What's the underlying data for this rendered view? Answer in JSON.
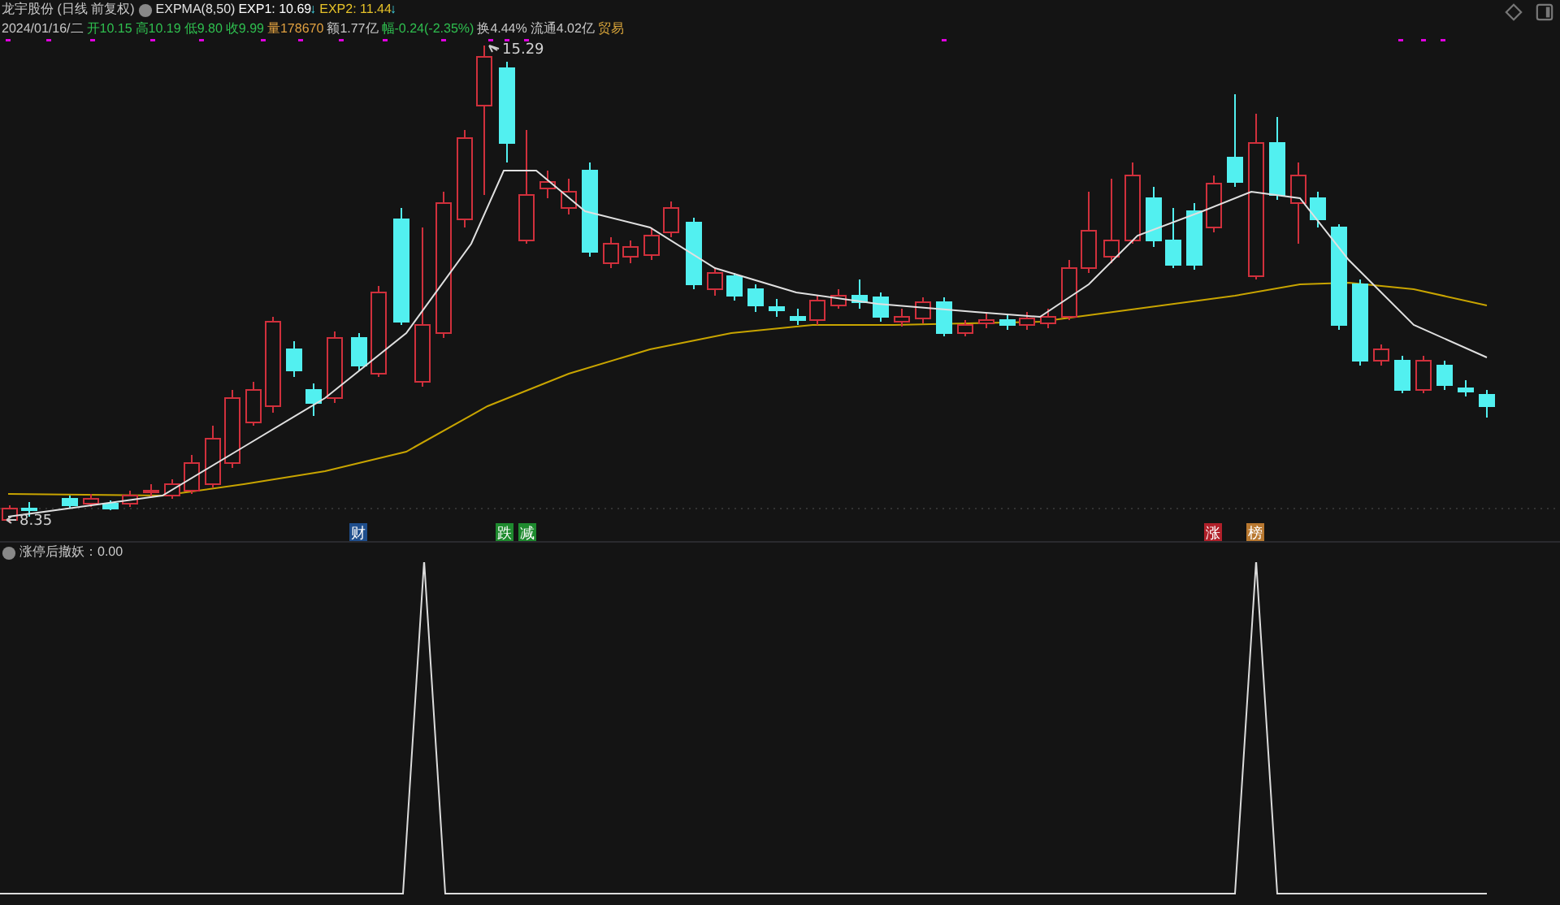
{
  "header": {
    "title": "龙宇股份 (日线 前复权)",
    "indicator": "EXPMA(8,50)",
    "values": [
      {
        "label": "EXP1: 10.69",
        "arrow": "↓",
        "color": "#ffffff"
      },
      {
        "label": "EXP2: 11.44",
        "arrow": "↓",
        "color": "#e6c229"
      }
    ]
  },
  "quote": [
    {
      "text": "2024/01/16/二",
      "color": "#c8c8c8"
    },
    {
      "text": "开10.15",
      "color": "#2fbf4f"
    },
    {
      "text": "高10.19",
      "color": "#2fbf4f"
    },
    {
      "text": "低9.80",
      "color": "#2fbf4f"
    },
    {
      "text": "收9.99",
      "color": "#2fbf4f"
    },
    {
      "text": "量178670",
      "color": "#e0a040"
    },
    {
      "text": "额1.77亿",
      "color": "#c8c8c8"
    },
    {
      "text": "幅-0.24(-2.35%)",
      "color": "#2fbf4f"
    },
    {
      "text": "换4.44%",
      "color": "#c8c8c8"
    },
    {
      "text": "流通4.02亿",
      "color": "#c8c8c8"
    },
    {
      "text": "贸易",
      "color": "#d9a53a"
    }
  ],
  "chart": {
    "high_label": "15.29",
    "low_label": "8.35",
    "markers": [
      {
        "text": "财",
        "color": "#1f4e8c"
      },
      {
        "text": "跌",
        "color": "#1e8a2e"
      },
      {
        "text": "减",
        "color": "#1e8a2e"
      },
      {
        "text": "涨",
        "color": "#b0202a"
      },
      {
        "text": "榜",
        "color": "#b87830"
      }
    ]
  },
  "lower_panel": {
    "label": "涨停后撤妖：0.00"
  }
}
